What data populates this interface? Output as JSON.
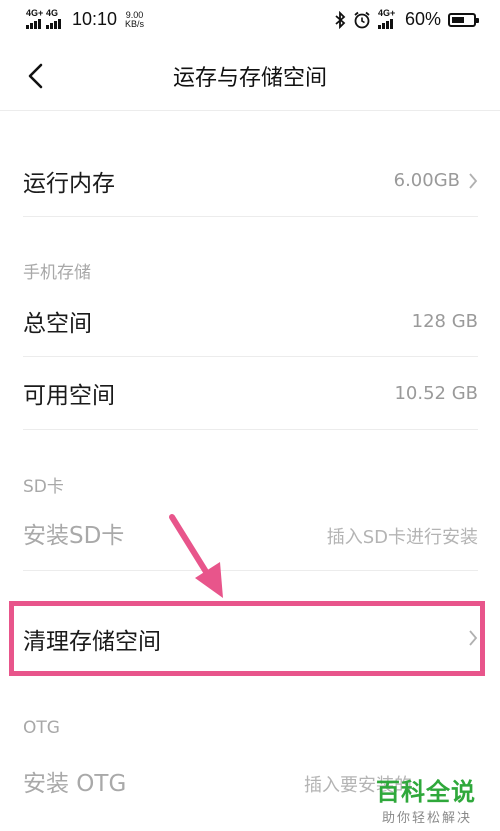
{
  "status_bar": {
    "signal1": "4G+",
    "signal2": "4G",
    "time": "10:10",
    "speed_value": "9.00",
    "speed_unit": "KB/s",
    "signal3": "4G+",
    "battery": "60%",
    "battery_level": 0.6
  },
  "header": {
    "title": "运存与存储空间"
  },
  "ram": {
    "label": "运行内存",
    "value": "6.00GB"
  },
  "phone_storage": {
    "header": "手机存储",
    "total_label": "总空间",
    "total_value": "128 GB",
    "available_label": "可用空间",
    "available_value": "10.52 GB"
  },
  "sd_card": {
    "header": "SD卡",
    "install_label": "安装SD卡",
    "install_value": "插入SD卡进行安装"
  },
  "cleanup": {
    "label": "清理存储空间"
  },
  "otg": {
    "header": "OTG",
    "install_label": "安装 OTG",
    "install_value": "插入要安装的"
  },
  "watermark": {
    "title": "百科全说",
    "subtitle": "助你轻松解决"
  },
  "colors": {
    "highlight": "#e8558b",
    "watermark": "#2fa83b"
  }
}
